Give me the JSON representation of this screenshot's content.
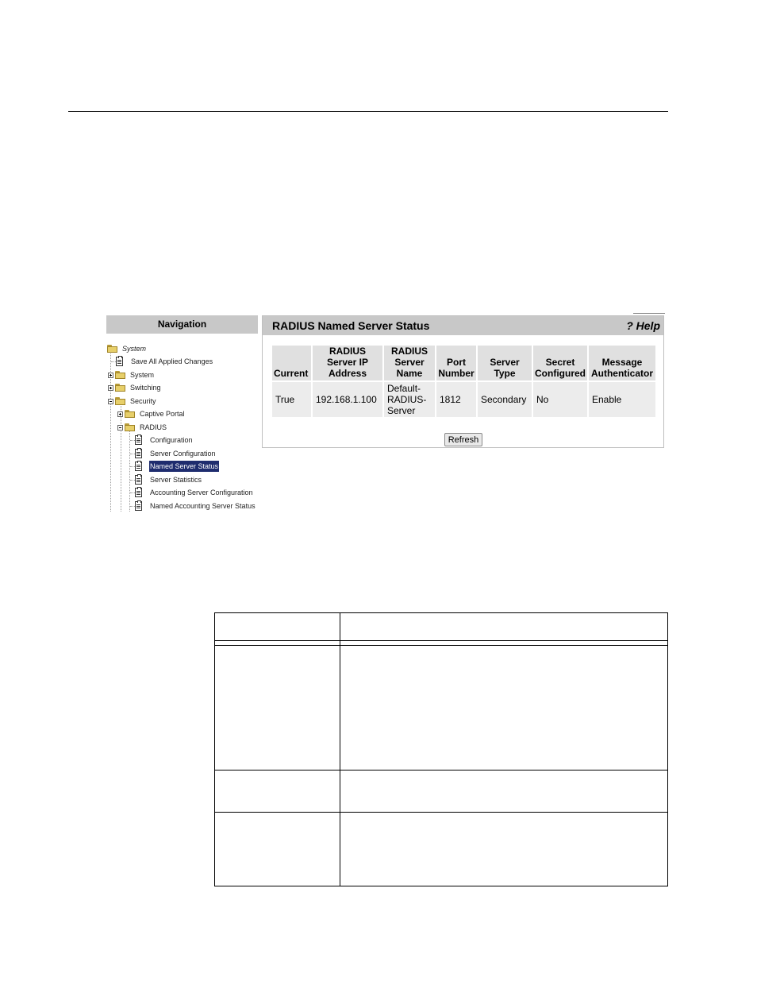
{
  "navigation": {
    "header": "Navigation",
    "tree": [
      {
        "label": "System",
        "type": "root",
        "italic": true
      },
      {
        "label": "Save All Applied Changes",
        "type": "page"
      },
      {
        "label": "System",
        "type": "folder",
        "expanded": false
      },
      {
        "label": "Switching",
        "type": "folder",
        "expanded": false
      },
      {
        "label": "Security",
        "type": "folder",
        "expanded": true
      },
      {
        "label": "Captive Portal",
        "type": "folder",
        "expanded": false
      },
      {
        "label": "RADIUS",
        "type": "folder",
        "expanded": true
      },
      {
        "label": "Configuration",
        "type": "page"
      },
      {
        "label": "Server Configuration",
        "type": "page"
      },
      {
        "label": "Named Server Status",
        "type": "page",
        "selected": true
      },
      {
        "label": "Server Statistics",
        "type": "page"
      },
      {
        "label": "Accounting Server Configuration",
        "type": "page"
      },
      {
        "label": "Named Accounting Server Status",
        "type": "page"
      }
    ]
  },
  "main": {
    "title": "RADIUS Named Server Status",
    "help": "? Help",
    "refresh_label": "Refresh",
    "table": {
      "headers": [
        "Current",
        "RADIUS Server IP Address",
        "RADIUS Server Name",
        "Port Number",
        "Server Type",
        "Secret Configured",
        "Message Authenticator"
      ],
      "rows": [
        [
          "True",
          "192.168.1.100",
          "Default-RADIUS-Server",
          "1812",
          "Secondary",
          "No",
          "Enable"
        ]
      ]
    }
  },
  "colors": {
    "header_bg": "#c8c8c8",
    "selected_bg": "#1e2c6e",
    "th_bg": "#e0e0e0",
    "td_bg": "#ececec"
  }
}
